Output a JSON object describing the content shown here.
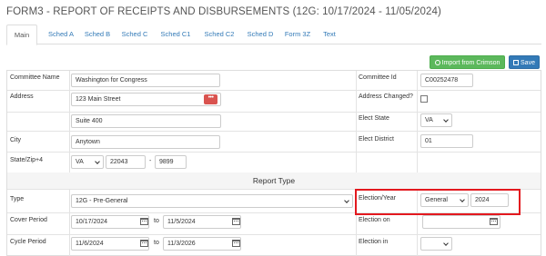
{
  "page": {
    "title": "FORM3 - REPORT OF RECEIPTS AND DISBURSEMENTS (12G: 10/17/2024 - 11/05/2024)"
  },
  "tabs": [
    {
      "label": "Main",
      "active": true
    },
    {
      "label": "Sched A"
    },
    {
      "label": "Sched B"
    },
    {
      "label": "Sched C"
    },
    {
      "label": "Sched C1"
    },
    {
      "label": "Sched C2"
    },
    {
      "label": "Sched D"
    },
    {
      "label": "Form 3Z"
    },
    {
      "label": "Text"
    }
  ],
  "actions": {
    "import_label": "Import from Crimson",
    "save_label": "Save"
  },
  "form": {
    "committee_name_label": "Committee Name",
    "committee_name": "Washington for Congress",
    "address_label": "Address",
    "address1": "123 Main Street",
    "address2": "Suite 400",
    "city_label": "City",
    "city": "Anytown",
    "state_zip_label": "State/Zip+4",
    "state": "VA",
    "zip": "22043",
    "zip_sep": "-",
    "zip4": "9899",
    "committee_id_label": "Committee Id",
    "committee_id": "C00252478",
    "address_changed_label": "Address Changed?",
    "elect_state_label": "Elect State",
    "elect_state": "VA",
    "elect_district_label": "Elect District",
    "elect_district": "01"
  },
  "report_type": {
    "section_title": "Report Type",
    "type_label": "Type",
    "type_value": "12G - Pre-General",
    "cover_period_label": "Cover Period",
    "cover_from": "10/17/2024",
    "cover_to": "11/5/2024",
    "to_label": "to",
    "cycle_period_label": "Cycle Period",
    "cycle_from": "11/6/2024",
    "cycle_to": "11/3/2026",
    "election_year_label": "Election/Year",
    "election_type": "General",
    "election_year": "2024",
    "election_on_label": "Election on",
    "election_on": "",
    "election_in_label": "Election in",
    "election_in": ""
  },
  "colors": {
    "accent": "#337ab7",
    "import_button": "#5cb85c",
    "highlight": "#e3191f",
    "dots_button": "#d9534f"
  }
}
